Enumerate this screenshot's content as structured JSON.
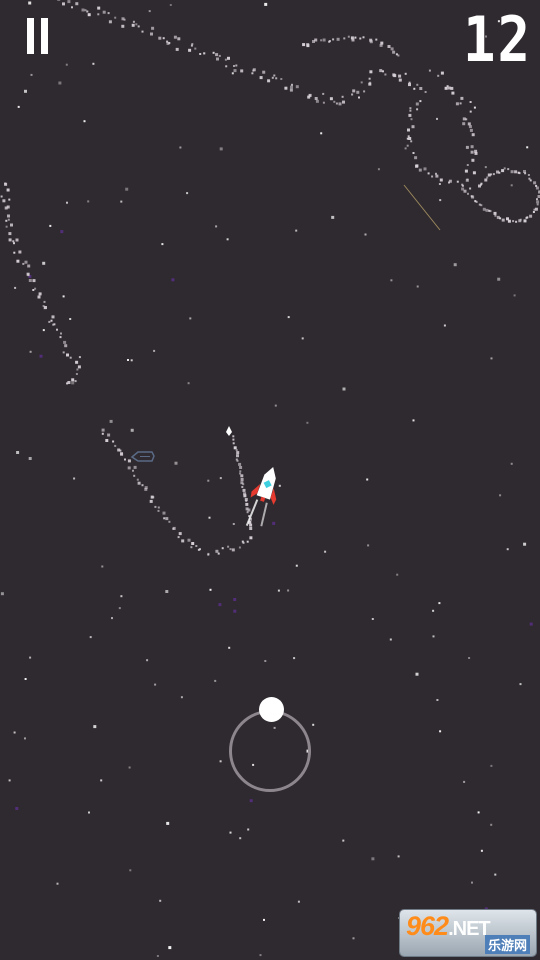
{
  "hud": {
    "score": "12",
    "pause_icon": "pause-icon"
  },
  "scene": {
    "background_color": "#2f2a2f",
    "star_color": "#ffffff",
    "trail_color": "#d8d2d8",
    "rocket": {
      "body_color": "#ffffff",
      "fin_color": "#e43a2f",
      "window_color": "#3fd0e0",
      "icon": "rocket-icon"
    },
    "enemy": {
      "color": "#5a6a86",
      "icon": "enemy-ship-icon"
    }
  },
  "controls": {
    "joystick_ring_color": "#8d878d",
    "joystick_knob_color": "#ffffff"
  },
  "watermark": {
    "brand_digits": "962",
    "brand_suffix": ".NET",
    "subtitle": "乐游网"
  }
}
